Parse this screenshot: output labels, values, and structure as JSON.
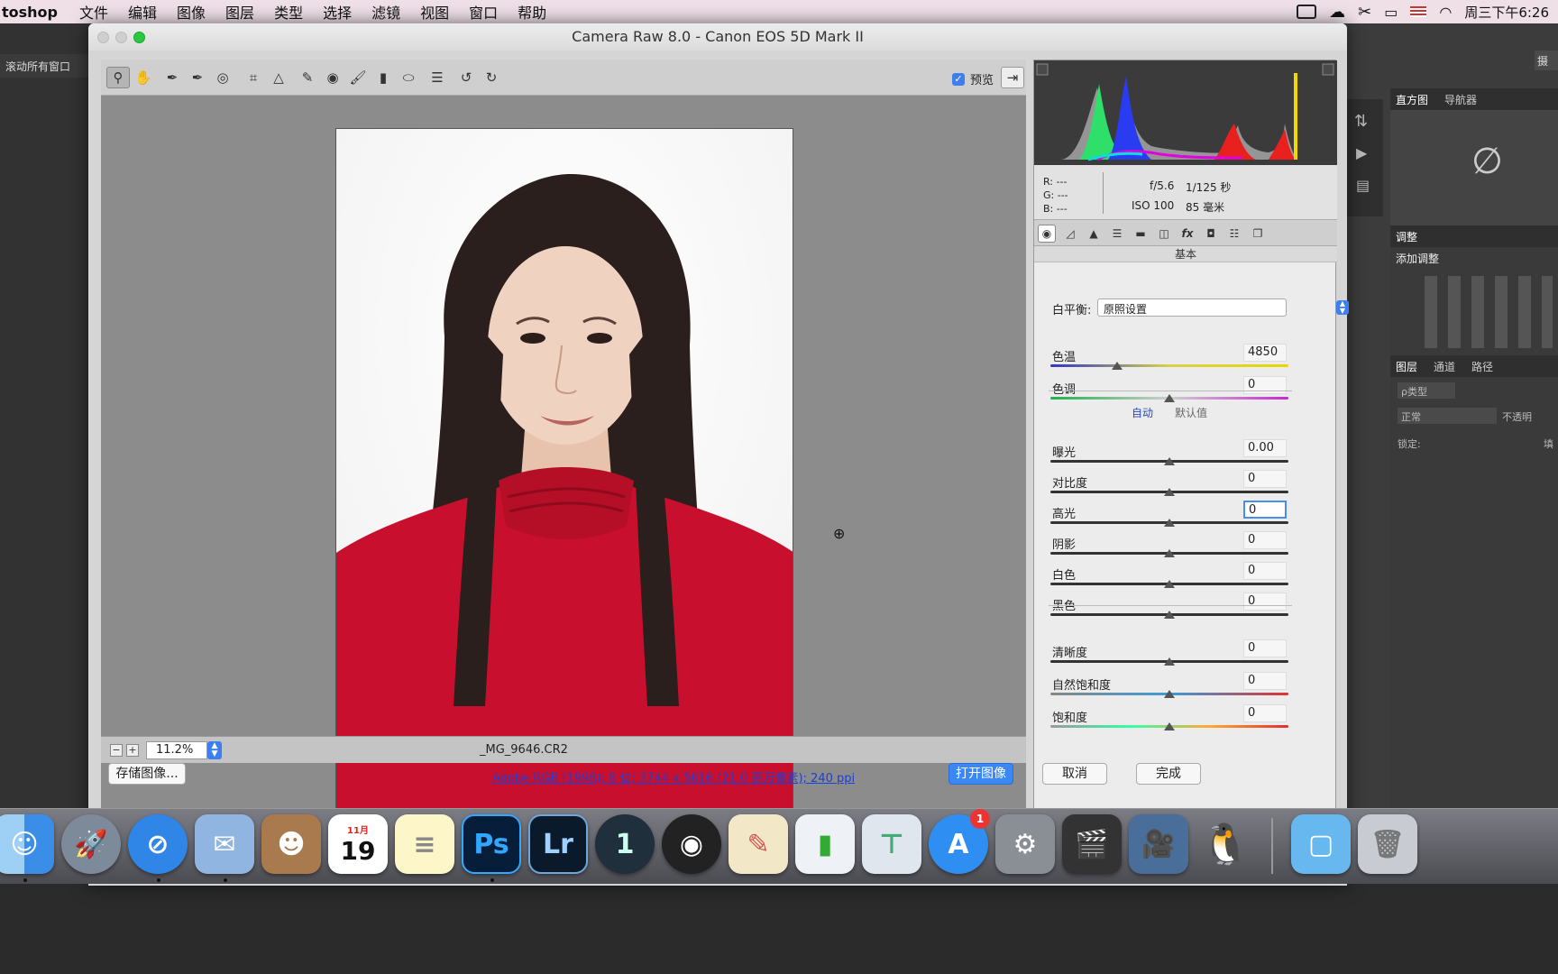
{
  "menubar": {
    "app": "toshop",
    "items": [
      "文件",
      "编辑",
      "图像",
      "图层",
      "类型",
      "选择",
      "滤镜",
      "视图",
      "窗口",
      "帮助"
    ],
    "clock": "周三下午6:26"
  },
  "ps": {
    "left_tab": "滚动所有窗口",
    "right_partial": "摄",
    "panels": {
      "histogram_tab": "直方图",
      "navigator_tab": "导航器",
      "adjust_head": "调整",
      "add_adjust": "添加调整",
      "layers_tab": "图层",
      "channels_tab": "通道",
      "paths_tab": "路径",
      "kind_filter": "ρ类型",
      "blend_mode": "正常",
      "opacity_label": "不透明",
      "lock_label": "锁定:",
      "fill_label": "填"
    }
  },
  "dialog": {
    "title": "Camera Raw 8.0 -  Canon EOS 5D Mark II",
    "preview_label": "预览",
    "zoom": "11.2%",
    "file_name": "_MG_9646.CR2",
    "save_button": "存储图像...",
    "info_link": "Adobe RGB (1998); 8 位; 3744 x 5616 (21.0 百万像素); 240 ppi",
    "open_button": "打开图像",
    "cancel_button": "取消",
    "done_button": "完成"
  },
  "caminfo": {
    "r": "R:  ---",
    "g": "G:  ---",
    "b": "B:  ---",
    "aperture": "f/5.6",
    "shutter": "1/125 秒",
    "iso": "ISO 100",
    "focal": "85 毫米"
  },
  "basic": {
    "panel_name": "基本",
    "wb_label": "白平衡:",
    "wb_value": "原照设置",
    "auto_label": "自动",
    "default_label": "默认值",
    "sliders": [
      {
        "label": "色温",
        "value": "4850",
        "pos": 0.28
      },
      {
        "label": "色调",
        "value": "0",
        "pos": 0.5
      },
      {
        "label": "曝光",
        "value": "0.00",
        "pos": 0.5
      },
      {
        "label": "对比度",
        "value": "0",
        "pos": 0.5
      },
      {
        "label": "高光",
        "value": "0",
        "pos": 0.5
      },
      {
        "label": "阴影",
        "value": "0",
        "pos": 0.5
      },
      {
        "label": "白色",
        "value": "0",
        "pos": 0.5
      },
      {
        "label": "黑色",
        "value": "0",
        "pos": 0.5
      },
      {
        "label": "清晰度",
        "value": "0",
        "pos": 0.5
      },
      {
        "label": "自然饱和度",
        "value": "0",
        "pos": 0.5
      },
      {
        "label": "饱和度",
        "value": "0",
        "pos": 0.5
      }
    ]
  },
  "dock": {
    "calendar_month": "11月",
    "calendar_day": "19",
    "ps_label": "Ps",
    "lr_label": "Lr",
    "onepw_label": "1",
    "appstore_badge": "1"
  },
  "colors": {
    "accent": "#3b87f5",
    "photo_bg": "#ffffff",
    "shirt": "#c8102e"
  }
}
